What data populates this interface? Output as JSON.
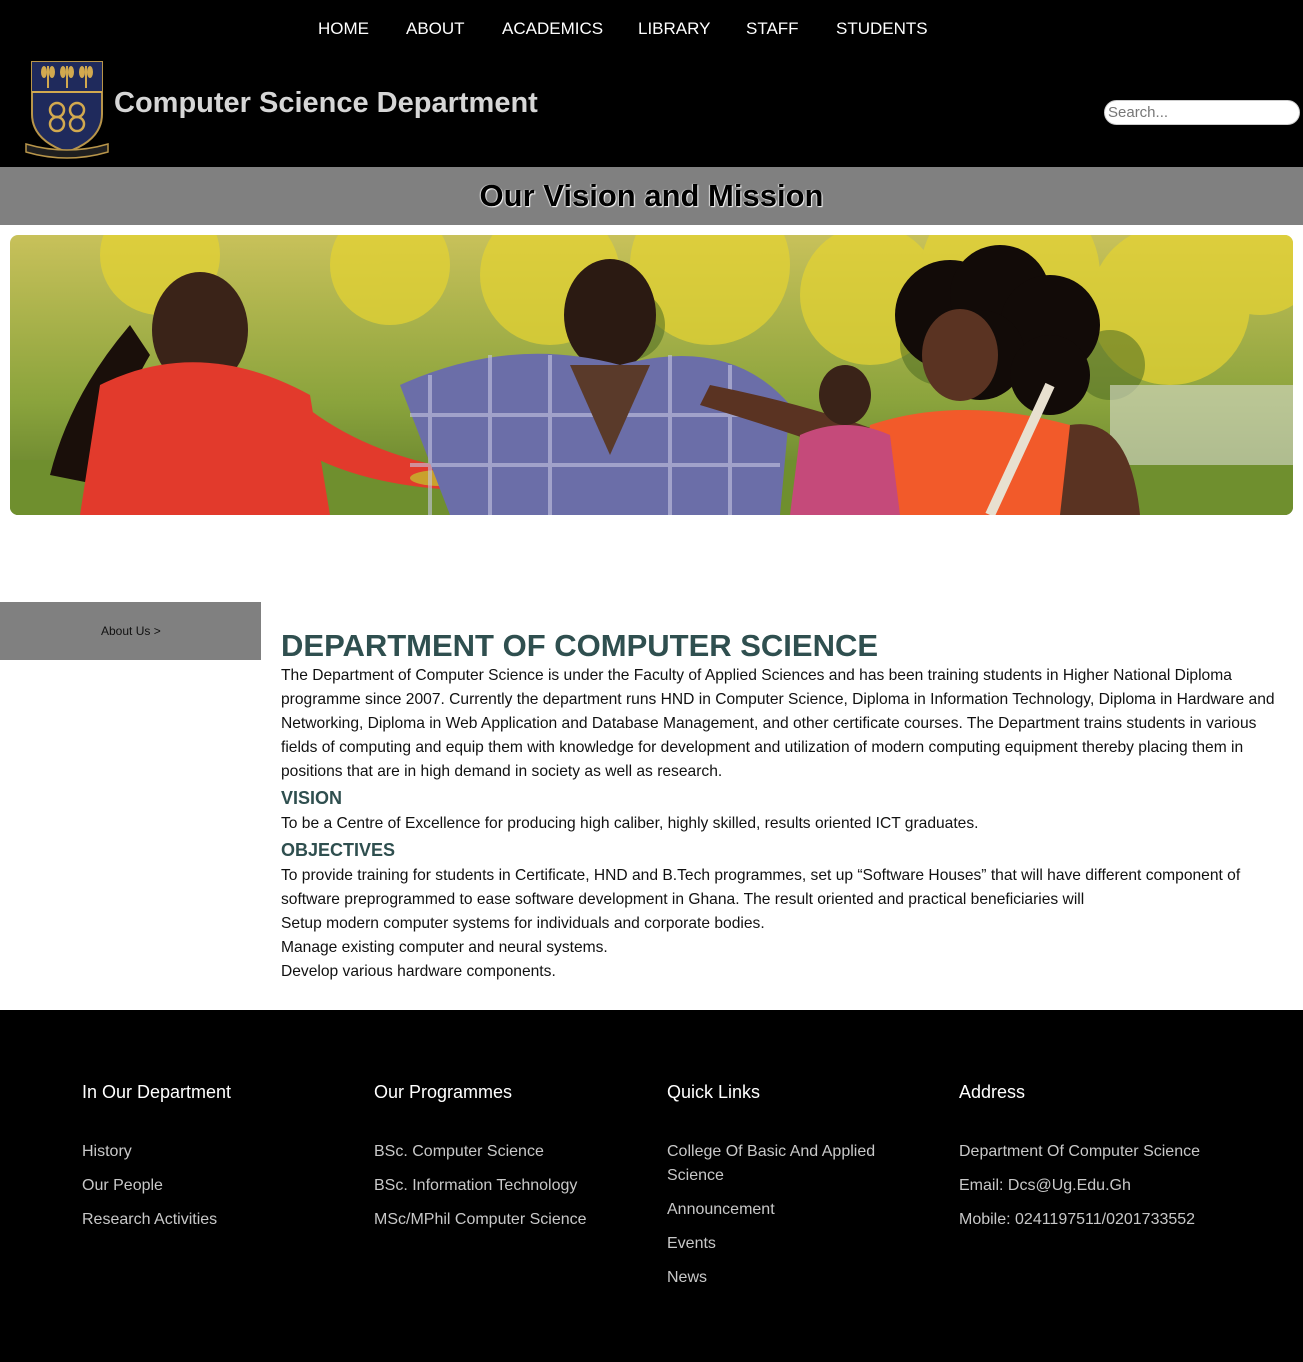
{
  "nav": {
    "items": [
      "HOME",
      "ABOUT",
      "ACADEMICS",
      "LIBRARY",
      "STAFF",
      "STUDENTS"
    ]
  },
  "header": {
    "logo_icon": "university-crest-icon",
    "title": "Computer Science Department",
    "search_placeholder": "Search..."
  },
  "band": {
    "title": "Our Vision and Mission"
  },
  "sidebar": {
    "item": "About Us >"
  },
  "content": {
    "heading": "DEPARTMENT OF COMPUTER SCIENCE",
    "intro": "The Department of Computer Science is under the Faculty of Applied Sciences and has been training students in Higher National Diploma programme since 2007. Currently the department runs HND in Computer Science, Diploma in Information Technology, Diploma in Hardware and Networking, Diploma in Web Application and Database Management, and other certificate courses. The Department trains students in various fields of computing and equip them with knowledge for development and utilization of modern computing equipment thereby placing them in positions that are in high demand in society as well as research.",
    "vision_heading": "VISION",
    "vision_text": "To be a Centre of Excellence for producing high caliber, highly skilled, results oriented ICT graduates.",
    "objectives_heading": "OBJECTIVES",
    "objectives_text": "To provide training for students in Certificate, HND and B.Tech programmes, set up “Software Houses” that will have different component of software preprogrammed to ease software development in Ghana. The result oriented and practical beneficiaries will",
    "objectives_list": [
      "Setup modern computer systems for individuals and corporate bodies.",
      "Manage existing computer and neural systems.",
      "Develop various hardware components."
    ]
  },
  "footer": {
    "department": {
      "heading": "In Our Department",
      "links": [
        "History",
        "Our People",
        "Research Activities"
      ]
    },
    "programmes": {
      "heading": "Our Programmes",
      "links": [
        "BSc. Computer Science",
        "BSc. Information Technology",
        "MSc/MPhil Computer Science"
      ]
    },
    "quick_links": {
      "heading": "Quick Links",
      "links": [
        "College Of Basic And Applied Science",
        "Announcement",
        "Events",
        "News"
      ]
    },
    "address": {
      "heading": "Address",
      "lines": [
        "Department Of Computer Science",
        "Email: Dcs@Ug.Edu.Gh",
        "Mobile: 0241197511/0201733552"
      ]
    }
  },
  "colors": {
    "header_bg": "#000000",
    "band_bg": "#808080",
    "heading_color": "#2f4f4f",
    "footer_link": "#c8c8c8"
  }
}
